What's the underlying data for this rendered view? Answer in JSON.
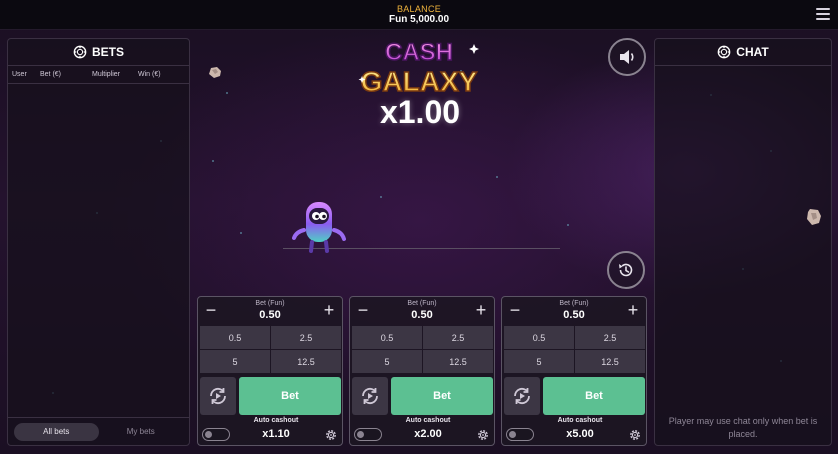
{
  "header": {
    "balance_label": "BALANCE",
    "balance_value": "Fun 5,000.00",
    "menu_icon": "hamburger-menu-icon"
  },
  "bets_panel": {
    "title": "BETS",
    "icon": "chip-icon",
    "columns": [
      "User",
      "Bet (€)",
      "Multiplier",
      "Win (€)"
    ],
    "tabs": [
      {
        "label": "All bets",
        "active": true
      },
      {
        "label": "My bets",
        "active": false
      }
    ]
  },
  "chat_panel": {
    "title": "CHAT",
    "icon": "chip-icon",
    "note": "Player may use chat only when bet is placed."
  },
  "game": {
    "logo_line1": "CASH",
    "logo_line2": "GALAXY",
    "multiplier": "x1.00",
    "sound_icon": "speaker-icon",
    "history_icon": "history-icon"
  },
  "bet_cards": [
    {
      "stake_label": "Bet (Fun)",
      "stake_value": "0.50",
      "quick_values": [
        "0.5",
        "2.5",
        "5",
        "12.5"
      ],
      "bet_label": "Bet",
      "auto_cashout_label": "Auto cashout",
      "auto_cashout_value": "x1.10",
      "auto_cashout_enabled": false
    },
    {
      "stake_label": "Bet (Fun)",
      "stake_value": "0.50",
      "quick_values": [
        "0.5",
        "2.5",
        "5",
        "12.5"
      ],
      "bet_label": "Bet",
      "auto_cashout_label": "Auto cashout",
      "auto_cashout_value": "x2.00",
      "auto_cashout_enabled": false
    },
    {
      "stake_label": "Bet (Fun)",
      "stake_value": "0.50",
      "quick_values": [
        "0.5",
        "2.5",
        "5",
        "12.5"
      ],
      "bet_label": "Bet",
      "auto_cashout_label": "Auto cashout",
      "auto_cashout_value": "x5.00",
      "auto_cashout_enabled": false
    }
  ],
  "colors": {
    "bet_button": "#5cc092",
    "balance_label": "#f0b43c",
    "background": "#24122e"
  }
}
